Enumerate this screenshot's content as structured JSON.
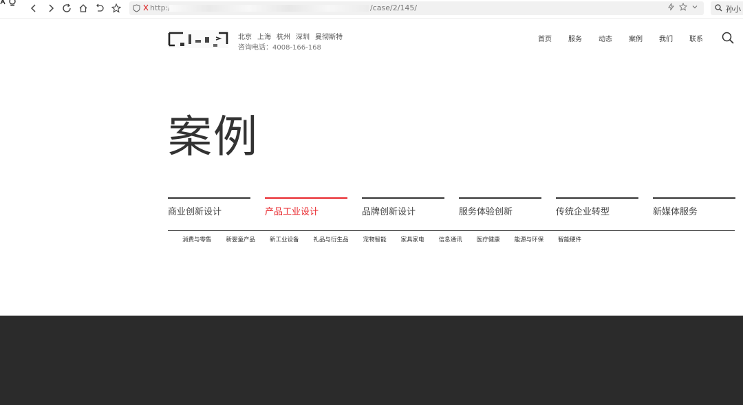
{
  "browser": {
    "url_protocol": "http://",
    "url_path": "/case/2/145/",
    "search_label": "孙小"
  },
  "header": {
    "cities": [
      "北京",
      "上海",
      "杭州",
      "深圳",
      "曼彻斯特"
    ],
    "phone": "咨询电话：4008-166-168",
    "nav": [
      "首页",
      "服务",
      "动态",
      "案例",
      "我们",
      "联系"
    ]
  },
  "page": {
    "title": "案例"
  },
  "categories": [
    {
      "label": "商业创新设计",
      "active": false
    },
    {
      "label": "产品工业设计",
      "active": true
    },
    {
      "label": "品牌创新设计",
      "active": false
    },
    {
      "label": "服务体验创新",
      "active": false
    },
    {
      "label": "传统企业转型",
      "active": false
    },
    {
      "label": "新媒体服务",
      "active": false
    }
  ],
  "subcategories": [
    "消费与零售",
    "新婴童产品",
    "新工业设备",
    "礼品与衍生品",
    "宠物智能",
    "家具家电",
    "信息通讯",
    "医疗健康",
    "能源与环保",
    "智能硬件"
  ],
  "colors": {
    "accent": "#e8262b",
    "footer": "#2b2b2b",
    "text": "#333333"
  }
}
